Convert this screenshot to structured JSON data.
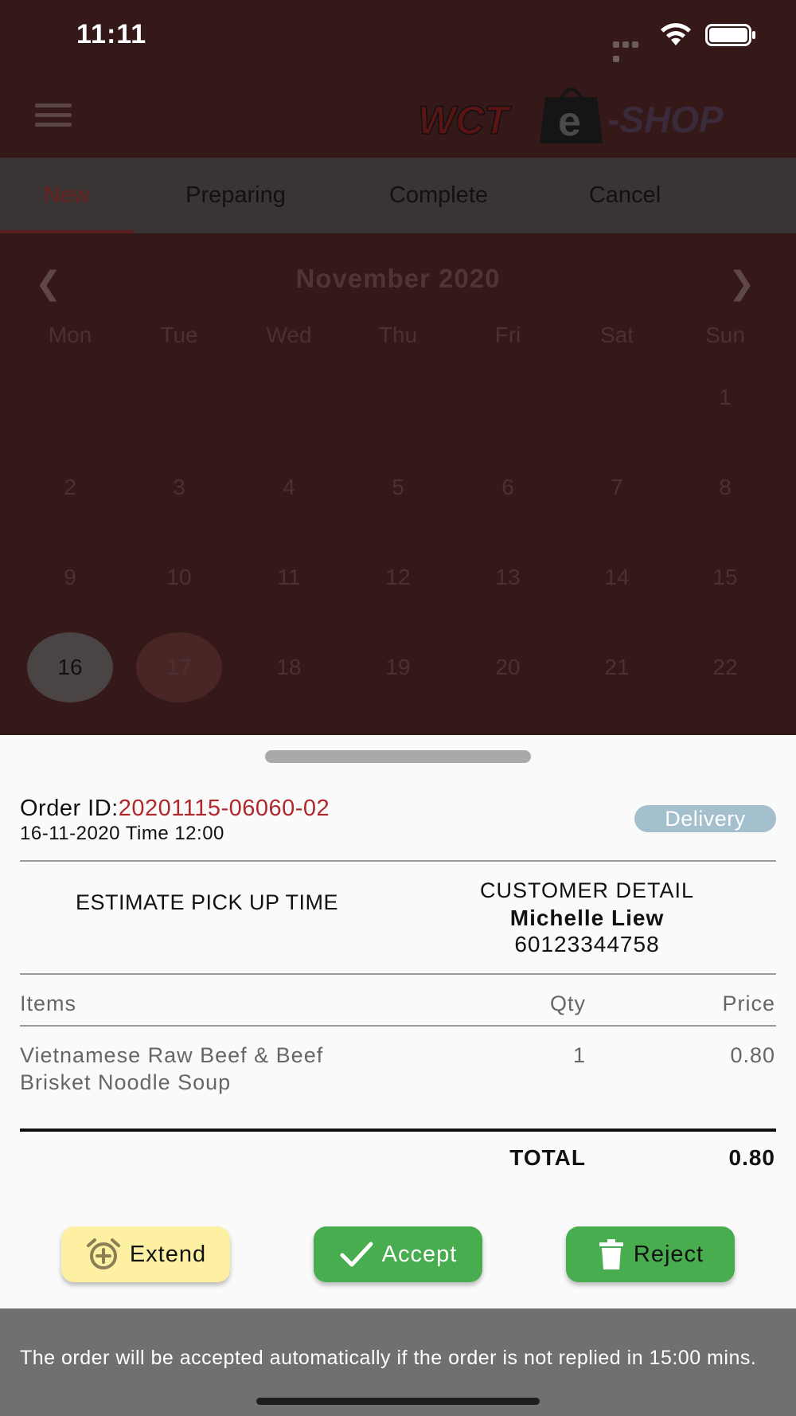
{
  "status_bar": {
    "time": "11:11"
  },
  "header": {
    "logo_text_left": "WCT",
    "logo_bag_letter": "e",
    "logo_text_right": "-SHOP"
  },
  "tabs": [
    {
      "label": "New",
      "active": true
    },
    {
      "label": "Preparing",
      "active": false
    },
    {
      "label": "Complete",
      "active": false
    },
    {
      "label": "Cancel",
      "active": false
    }
  ],
  "calendar": {
    "month_title": "November 2020",
    "weekdays": [
      "Mon",
      "Tue",
      "Wed",
      "Thu",
      "Fri",
      "Sat",
      "Sun"
    ],
    "weeks": [
      [
        "",
        "",
        "",
        "",
        "",
        "",
        "1"
      ],
      [
        "2",
        "3",
        "4",
        "5",
        "6",
        "7",
        "8"
      ],
      [
        "9",
        "10",
        "11",
        "12",
        "13",
        "14",
        "15"
      ],
      [
        "16",
        "17",
        "18",
        "19",
        "20",
        "21",
        "22"
      ]
    ],
    "selected_day": "16",
    "today_day": "17"
  },
  "order": {
    "id_label": "Order ID:",
    "id_value": "20201115-06060-02",
    "datetime": "16-11-2020 Time 12:00",
    "type_badge": "Delivery",
    "estimate_label": "ESTIMATE PICK UP TIME",
    "customer_title": "CUSTOMER DETAIL",
    "customer_name": "Michelle Liew",
    "customer_phone": "60123344758",
    "columns": {
      "items": "Items",
      "qty": "Qty",
      "price": "Price"
    },
    "items": [
      {
        "name_line1": "Vietnamese Raw Beef & Beef",
        "name_line2": "Brisket Noodle Soup",
        "qty": "1",
        "price": "0.80"
      }
    ],
    "total_label": "TOTAL",
    "total_value": "0.80"
  },
  "actions": {
    "extend": "Extend",
    "accept": "Accept",
    "reject": "Reject"
  },
  "footer": {
    "note": "The order will be accepted automatically if the order is not replied in 15:00 mins."
  },
  "colors": {
    "accent": "#b0282c",
    "green": "#48ad4f",
    "extend_yellow": "#fdf0a2",
    "badge": "#a4bfcd"
  }
}
